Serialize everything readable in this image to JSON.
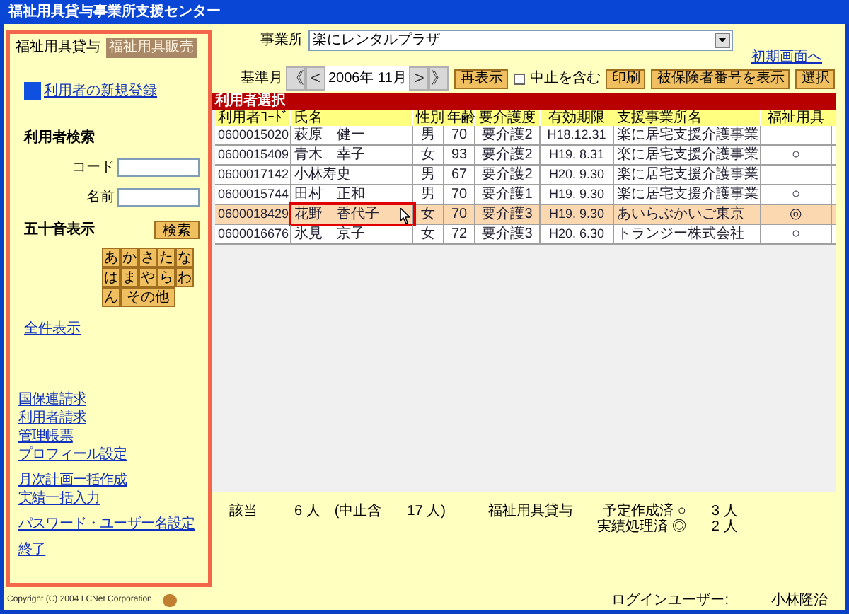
{
  "window": {
    "title": "福祉用具貸与事業所支援センター"
  },
  "tabs": [
    {
      "label": "福祉用具貸与",
      "selected": true
    },
    {
      "label": "福祉用具販売",
      "selected": false
    }
  ],
  "sidebar": {
    "new_user_link": "利用者の新規登録",
    "search_title": "利用者検索",
    "fields": [
      {
        "label": "コード"
      },
      {
        "label": "名前"
      }
    ],
    "kana_title": "五十音表示",
    "search_button": "検索",
    "kana_buttons": [
      {
        "label": "あ"
      },
      {
        "label": "か"
      },
      {
        "label": "さ"
      },
      {
        "label": "た"
      },
      {
        "label": "な"
      },
      {
        "label": "は"
      },
      {
        "label": "ま"
      },
      {
        "label": "や"
      },
      {
        "label": "ら"
      },
      {
        "label": "わ"
      },
      {
        "label": "ん"
      },
      {
        "label": "その他",
        "wide": true
      }
    ],
    "show_all_link": "全件表示",
    "menu_groups": [
      [
        "国保連請求",
        "利用者請求",
        "管理帳票",
        "プロフィール設定"
      ],
      [
        "月次計画一括作成",
        "実績一括入力"
      ],
      [
        "パスワード・ユーザー名設定"
      ],
      [
        "終了"
      ]
    ]
  },
  "office": {
    "label": "事業所",
    "value": "楽にレンタルプラザ"
  },
  "home_link": "初期画面へ",
  "month_bar": {
    "label": "基準月",
    "first": "《",
    "prev": "<",
    "month": "2006年 11月",
    "next": ">",
    "last": "》"
  },
  "buttons": [
    {
      "kind": "button",
      "label": "再表示"
    },
    {
      "kind": "checkbox",
      "label": "中止を含む",
      "checked": false
    },
    {
      "kind": "button",
      "label": "印刷"
    },
    {
      "kind": "button",
      "label": "被保険者番号を表示"
    },
    {
      "kind": "button",
      "label": "選択"
    }
  ],
  "table": {
    "title": "利用者選択",
    "columns": [
      "利用者ｺｰﾄﾞ",
      "氏名",
      "性別",
      "年齢",
      "要介護度",
      "有効期限",
      "支援事業所名",
      "福祉用具"
    ],
    "rows": [
      {
        "cells": [
          "0600015020",
          "萩原　健一",
          "男",
          "70",
          "要介護2",
          "H18.12.31",
          "楽に居宅支援介護事業"
        ],
        "selected": false
      },
      {
        "cells": [
          "0600015409",
          "青木　幸子",
          "女",
          "93",
          "要介護2",
          "H19. 8.31",
          "楽に居宅支援介護事業",
          "○"
        ],
        "selected": false
      },
      {
        "cells": [
          "0600017142",
          "小林寿史",
          "男",
          "67",
          "要介護2",
          "H20. 9.30",
          "楽に居宅支援介護事業"
        ],
        "selected": false
      },
      {
        "cells": [
          "0600015744",
          "田村　正和",
          "男",
          "70",
          "要介護1",
          "H19. 9.30",
          "楽に居宅支援介護事業",
          "○"
        ],
        "selected": false
      },
      {
        "cells": [
          "0600018429",
          "花野　香代子",
          "女",
          "70",
          "要介護3",
          "H19. 9.30",
          "あいらぶかいご東京",
          "◎"
        ],
        "selected": true
      },
      {
        "cells": [
          "0600016676",
          "氷見　京子",
          "女",
          "72",
          "要介護3",
          "H20. 6.30",
          "トランジー株式会社",
          "○"
        ],
        "selected": false
      }
    ]
  },
  "summary": {
    "items": [
      "該当",
      "6 人",
      "(中止含",
      "17 人)",
      "福祉用具貸与"
    ],
    "legend": [
      {
        "label": "予定作成済 ○",
        "count": "3 人"
      },
      {
        "label": "実績処理済 ◎",
        "count": "2 人"
      }
    ]
  },
  "footer": {
    "copyright": "Copyright (C) 2004 LCNet Corporation",
    "login_label": "ログインユーザー:",
    "user": "小林隆治"
  }
}
